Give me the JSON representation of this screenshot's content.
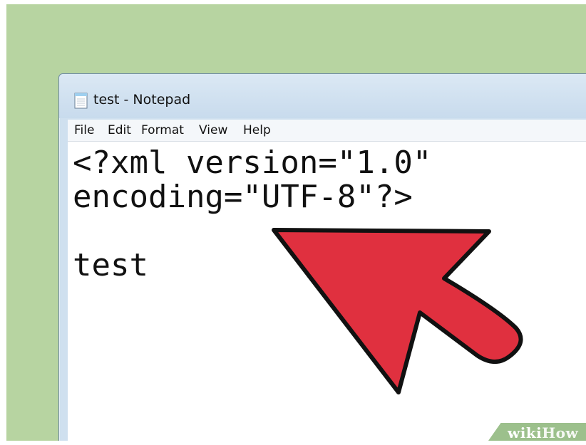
{
  "window": {
    "title": "test - Notepad"
  },
  "menu": {
    "items": [
      {
        "label": "File"
      },
      {
        "label": "Edit"
      },
      {
        "label": "Format"
      },
      {
        "label": "View"
      },
      {
        "label": "Help"
      }
    ]
  },
  "editor": {
    "lines": [
      "<?xml version=\"1.0\"",
      "encoding=\"UTF-8\"?>",
      "",
      "test"
    ]
  },
  "overlay": {
    "arrow_color": "#e0303f",
    "background_color": "#b7d4a1"
  },
  "watermark": {
    "part1": "wiki",
    "part2": "How"
  }
}
